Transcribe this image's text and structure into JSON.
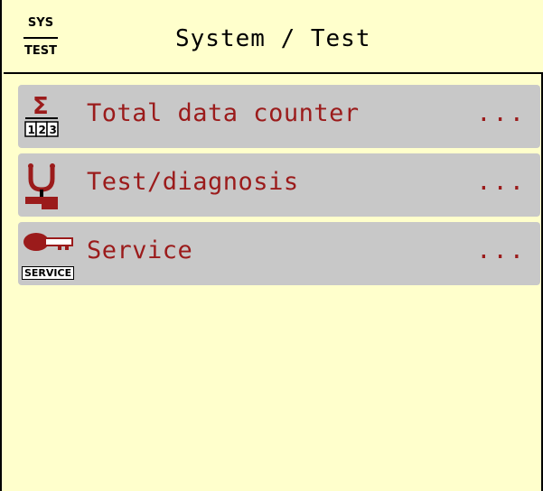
{
  "header": {
    "icon_top": "SYS",
    "icon_bottom": "TEST",
    "title": "System / Test"
  },
  "menu": {
    "items": [
      {
        "label": "Total data counter",
        "more": "...",
        "icon": "total-data-counter-icon"
      },
      {
        "label": "Test/diagnosis",
        "more": "...",
        "icon": "stethoscope-icon"
      },
      {
        "label": "Service",
        "more": "...",
        "icon": "service-key-icon",
        "icon_text": "SERVICE"
      }
    ]
  },
  "colors": {
    "background": "#ffffcc",
    "item_bg": "#c8c8c8",
    "text_red": "#9b1b1b"
  }
}
